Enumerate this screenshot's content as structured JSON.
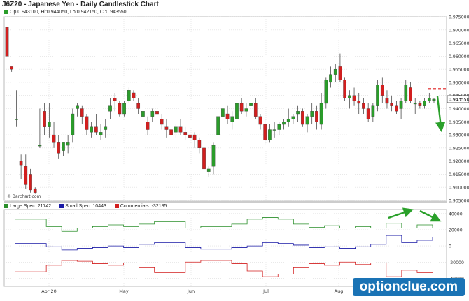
{
  "title": "J6Z20 - Japanese Yen - Daily Candlestick Chart",
  "ohlc_label": "Op:0.943100, Hi:0.944050, Lo:0.942150, Cl:0.943550",
  "copyright": "© Barchart.com",
  "last_price_label": "0.943550",
  "watermark": "optionclue.com",
  "colors": {
    "up": "#2a9d2a",
    "down": "#d21f1f",
    "large": "#2a8f2a",
    "small": "#1a1aa6",
    "commercial": "#d21f1f",
    "arrow": "#2aa02a",
    "dash": "#e02020"
  },
  "chart_data": [
    {
      "type": "candlestick",
      "y_ticks": [
        "0.975000",
        "0.970000",
        "0.965000",
        "0.960000",
        "0.955000",
        "0.950000",
        "0.945000",
        "0.940000",
        "0.935000",
        "0.930000",
        "0.925000",
        "0.920000",
        "0.915000",
        "0.910000",
        "0.905000"
      ],
      "x_ticks": [
        "Apr 20",
        "May",
        "Jun",
        "Jul",
        "Aug"
      ],
      "ylim": [
        0.905,
        0.975
      ],
      "candles": [
        [
          0.971,
          0.971,
          0.96,
          0.96
        ],
        [
          0.956,
          0.956,
          0.954,
          0.955
        ],
        [
          0.936,
          0.947,
          0.933,
          0.936
        ],
        [
          0.92,
          0.9225,
          0.913,
          0.9185
        ],
        [
          0.918,
          0.9225,
          0.9095,
          0.911
        ],
        [
          0.915,
          0.917,
          0.908,
          0.909
        ],
        [
          0.9095,
          0.91,
          0.9075,
          0.908
        ],
        [
          0.926,
          0.94,
          0.925,
          0.926
        ],
        [
          0.939,
          0.942,
          0.93,
          0.933
        ],
        [
          0.933,
          0.942,
          0.929,
          0.935
        ],
        [
          0.93,
          0.935,
          0.925,
          0.927
        ],
        [
          0.927,
          0.93,
          0.921,
          0.923
        ],
        [
          0.924,
          0.927,
          0.922,
          0.927
        ],
        [
          0.926,
          0.93,
          0.923,
          0.927
        ],
        [
          0.93,
          0.94,
          0.927,
          0.938
        ],
        [
          0.94,
          0.942,
          0.937,
          0.941
        ],
        [
          0.94,
          0.941,
          0.934,
          0.937
        ],
        [
          0.937,
          0.938,
          0.93,
          0.932
        ],
        [
          0.931,
          0.935,
          0.929,
          0.933
        ],
        [
          0.933,
          0.938,
          0.93,
          0.931
        ],
        [
          0.93,
          0.934,
          0.928,
          0.931
        ],
        [
          0.932,
          0.936,
          0.929,
          0.933
        ],
        [
          0.939,
          0.944,
          0.936,
          0.941
        ],
        [
          0.944,
          0.946,
          0.939,
          0.943
        ],
        [
          0.942,
          0.943,
          0.937,
          0.938
        ],
        [
          0.938,
          0.943,
          0.937,
          0.942
        ],
        [
          0.943,
          0.948,
          0.942,
          0.947
        ],
        [
          0.946,
          0.947,
          0.943,
          0.944
        ],
        [
          0.942,
          0.944,
          0.938,
          0.94
        ],
        [
          0.937,
          0.94,
          0.935,
          0.939
        ],
        [
          0.935,
          0.937,
          0.93,
          0.932
        ],
        [
          0.937,
          0.94,
          0.935,
          0.939
        ],
        [
          0.939,
          0.941,
          0.937,
          0.938
        ],
        [
          0.936,
          0.938,
          0.932,
          0.934
        ],
        [
          0.933,
          0.936,
          0.929,
          0.932
        ],
        [
          0.932,
          0.934,
          0.928,
          0.93
        ],
        [
          0.931,
          0.934,
          0.929,
          0.933
        ],
        [
          0.933,
          0.936,
          0.93,
          0.931
        ],
        [
          0.931,
          0.933,
          0.928,
          0.93
        ],
        [
          0.93,
          0.932,
          0.927,
          0.929
        ],
        [
          0.93,
          0.931,
          0.925,
          0.928
        ],
        [
          0.928,
          0.929,
          0.923,
          0.925
        ],
        [
          0.925,
          0.926,
          0.916,
          0.917
        ],
        [
          0.916,
          0.918,
          0.914,
          0.917
        ],
        [
          0.918,
          0.927,
          0.915,
          0.926
        ],
        [
          0.93,
          0.938,
          0.929,
          0.937
        ],
        [
          0.937,
          0.942,
          0.935,
          0.94
        ],
        [
          0.938,
          0.941,
          0.934,
          0.936
        ],
        [
          0.935,
          0.939,
          0.932,
          0.937
        ],
        [
          0.936,
          0.943,
          0.935,
          0.942
        ],
        [
          0.942,
          0.944,
          0.938,
          0.939
        ],
        [
          0.939,
          0.942,
          0.937,
          0.94
        ],
        [
          0.941,
          0.946,
          0.938,
          0.942
        ],
        [
          0.942,
          0.944,
          0.936,
          0.937
        ],
        [
          0.937,
          0.938,
          0.932,
          0.934
        ],
        [
          0.934,
          0.936,
          0.926,
          0.928
        ],
        [
          0.928,
          0.934,
          0.927,
          0.932
        ],
        [
          0.932,
          0.935,
          0.929,
          0.932
        ],
        [
          0.932,
          0.935,
          0.93,
          0.934
        ],
        [
          0.934,
          0.936,
          0.932,
          0.935
        ],
        [
          0.935,
          0.94,
          0.933,
          0.936
        ],
        [
          0.936,
          0.938,
          0.934,
          0.937
        ],
        [
          0.938,
          0.941,
          0.935,
          0.939
        ],
        [
          0.939,
          0.94,
          0.933,
          0.934
        ],
        [
          0.934,
          0.938,
          0.931,
          0.937
        ],
        [
          0.937,
          0.942,
          0.934,
          0.939
        ],
        [
          0.939,
          0.941,
          0.932,
          0.935
        ],
        [
          0.934,
          0.946,
          0.932,
          0.942
        ],
        [
          0.942,
          0.952,
          0.94,
          0.951
        ],
        [
          0.95,
          0.956,
          0.948,
          0.953
        ],
        [
          0.953,
          0.957,
          0.95,
          0.955
        ],
        [
          0.956,
          0.961,
          0.95,
          0.951
        ],
        [
          0.951,
          0.952,
          0.943,
          0.944
        ],
        [
          0.944,
          0.947,
          0.94,
          0.945
        ],
        [
          0.945,
          0.948,
          0.941,
          0.943
        ],
        [
          0.943,
          0.946,
          0.938,
          0.942
        ],
        [
          0.942,
          0.944,
          0.938,
          0.94
        ],
        [
          0.94,
          0.942,
          0.935,
          0.936
        ],
        [
          0.937,
          0.942,
          0.935,
          0.941
        ],
        [
          0.941,
          0.951,
          0.939,
          0.949
        ],
        [
          0.949,
          0.952,
          0.942,
          0.945
        ],
        [
          0.944,
          0.947,
          0.94,
          0.942
        ],
        [
          0.942,
          0.945,
          0.939,
          0.941
        ],
        [
          0.941,
          0.943,
          0.938,
          0.939
        ],
        [
          0.94,
          0.944,
          0.936,
          0.943
        ],
        [
          0.943,
          0.951,
          0.942,
          0.949
        ],
        [
          0.948,
          0.95,
          0.942,
          0.943
        ],
        [
          0.942,
          0.944,
          0.938,
          0.942
        ],
        [
          0.942,
          0.943,
          0.94,
          0.941
        ],
        [
          0.941,
          0.944,
          0.94,
          0.943
        ],
        [
          0.943,
          0.946,
          0.942,
          0.944
        ],
        [
          0.9431,
          0.9441,
          0.9422,
          0.9436
        ]
      ],
      "projection_level": 0.9475
    },
    {
      "type": "line",
      "y_ticks": [
        "40000",
        "20000",
        "0",
        "-20000",
        "-40000"
      ],
      "ylim": [
        -50000,
        45000
      ],
      "series": [
        {
          "name": "Large Spec: 21742",
          "values": [
            33000,
            33000,
            24000,
            18000,
            22000,
            24000,
            26000,
            24000,
            27000,
            30000,
            30000,
            22000,
            24000,
            24000,
            27000,
            33000,
            35000,
            33000,
            27000,
            23000,
            25000,
            22000,
            24000,
            22000,
            28000,
            22000,
            26000,
            21742
          ]
        },
        {
          "name": "Small Spec: 10443",
          "values": [
            3000,
            3000,
            -1000,
            -5000,
            -3000,
            -2000,
            0,
            -2000,
            2000,
            4000,
            4000,
            -2000,
            -4000,
            -4000,
            -2000,
            0,
            4000,
            3000,
            1000,
            -2000,
            -1000,
            -3000,
            -1000,
            2000,
            13000,
            4000,
            7000,
            10443
          ]
        },
        {
          "name": "Commercials: -32185",
          "values": [
            -32000,
            -32000,
            -24000,
            -18000,
            -19000,
            -22000,
            -24000,
            -21000,
            -27000,
            -33000,
            -33000,
            -20000,
            -18000,
            -18000,
            -22000,
            -31000,
            -38000,
            -35000,
            -27000,
            -22000,
            -24000,
            -20000,
            -23000,
            -21000,
            -38000,
            -30000,
            -33000,
            -32185
          ]
        }
      ]
    }
  ]
}
